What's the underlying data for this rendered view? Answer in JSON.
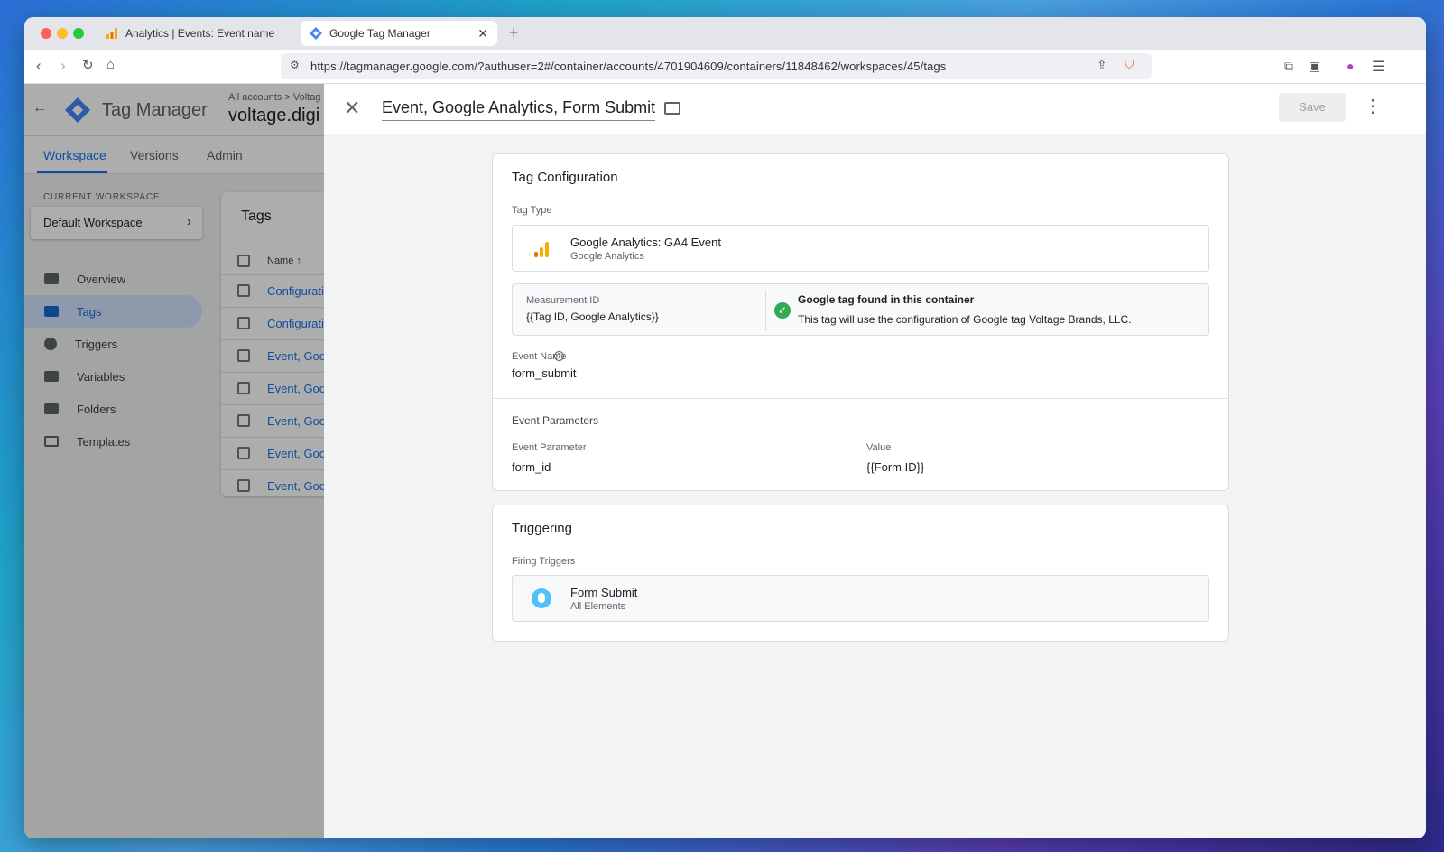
{
  "browser": {
    "tabs": [
      {
        "label": "Analytics | Events: Event name"
      },
      {
        "label": "Google Tag Manager"
      }
    ],
    "url": "https://tagmanager.google.com/?authuser=2#/container/accounts/4701904609/containers/11848462/workspaces/45/tags"
  },
  "gtm": {
    "app_name": "Tag Manager",
    "breadcrumb": "All accounts > Voltag",
    "container_name": "voltage.digi",
    "nav_tabs": [
      {
        "label": "Workspace"
      },
      {
        "label": "Versions"
      },
      {
        "label": "Admin"
      }
    ],
    "current_workspace_label": "CURRENT WORKSPACE",
    "workspace_name": "Default Workspace",
    "sidebar": [
      {
        "label": "Overview"
      },
      {
        "label": "Tags"
      },
      {
        "label": "Triggers"
      },
      {
        "label": "Variables"
      },
      {
        "label": "Folders"
      },
      {
        "label": "Templates"
      }
    ],
    "tags_title": "Tags",
    "tags_column": "Name ↑",
    "tags_rows": [
      "Configurati",
      "Configurati",
      "Event, Goog",
      "Event, Goog",
      "Event, Goog",
      "Event, Goog",
      "Event, Goog"
    ]
  },
  "panel": {
    "title": "Event, Google Analytics, Form Submit",
    "save_label": "Save",
    "tag_config": {
      "title": "Tag Configuration",
      "tag_type_label": "Tag Type",
      "tag_type_name": "Google Analytics: GA4 Event",
      "tag_type_vendor": "Google Analytics",
      "measurement_label": "Measurement ID",
      "measurement_value": "{{Tag ID, Google Analytics}}",
      "found_title": "Google tag found in this container",
      "found_desc": "This tag will use the configuration of Google tag Voltage Brands, LLC.",
      "event_name_label": "Event Name",
      "event_name_value": "form_submit",
      "params_title": "Event Parameters",
      "param_col": "Event Parameter",
      "value_col": "Value",
      "param_name": "form_id",
      "param_value": "{{Form ID}}"
    },
    "triggering": {
      "title": "Triggering",
      "firing_label": "Firing Triggers",
      "trigger_name": "Form Submit",
      "trigger_sub": "All Elements"
    }
  }
}
